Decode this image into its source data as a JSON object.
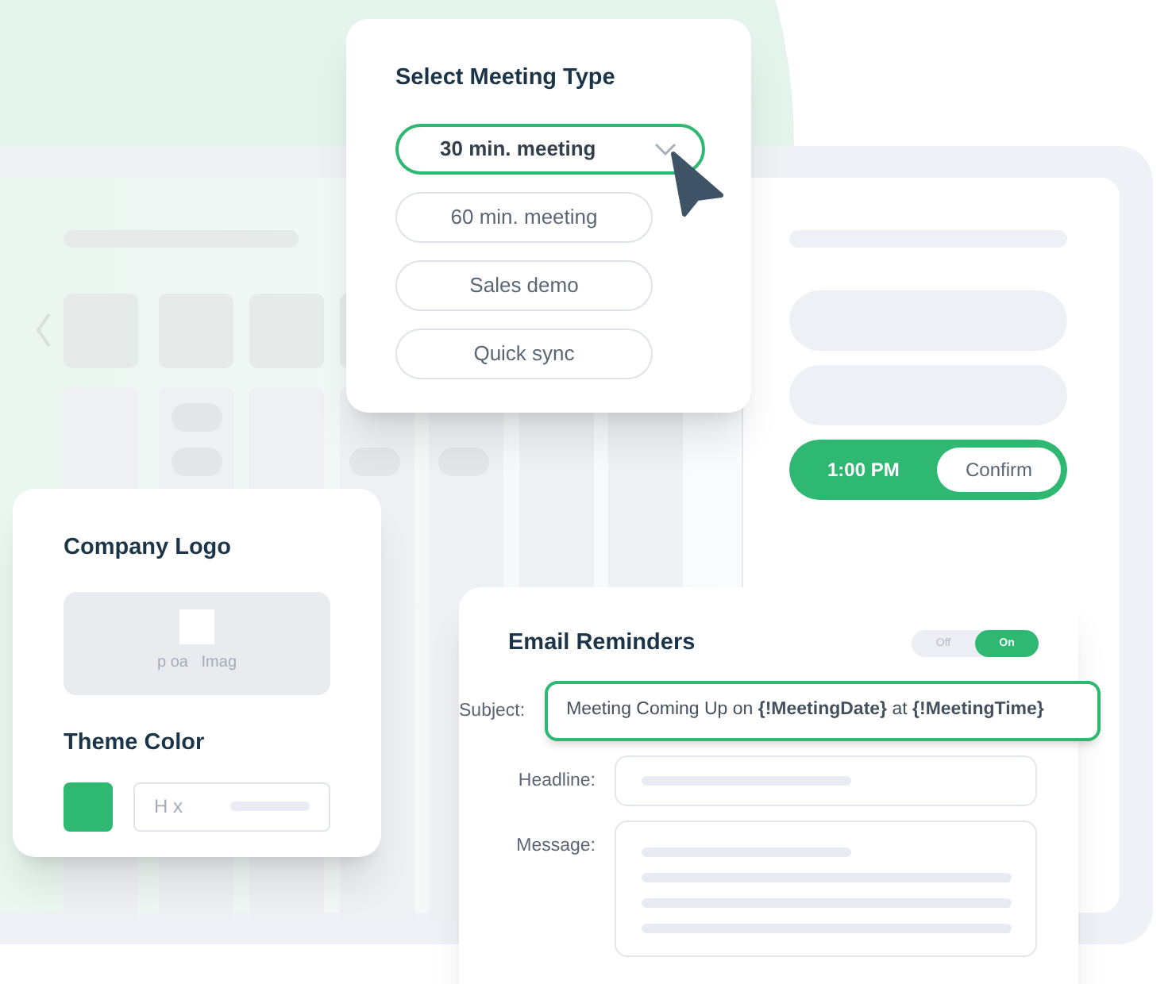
{
  "meeting_type": {
    "title": "Select Meeting Type",
    "options": [
      {
        "label": "30 min. meeting",
        "selected": true
      },
      {
        "label": "60 min. meeting",
        "selected": false
      },
      {
        "label": "Sales demo",
        "selected": false
      },
      {
        "label": "Quick sync",
        "selected": false
      }
    ]
  },
  "time_slot": {
    "time": "1:00 PM",
    "button": "Confirm"
  },
  "company_logo": {
    "title": "Company Logo",
    "upload_text": "p oa   Imag"
  },
  "theme_color": {
    "title": "Theme Color",
    "color": "#2eb872",
    "hex_placeholder": "H x"
  },
  "email_reminders": {
    "title": "Email Reminders",
    "toggle": [
      {
        "label": "Off",
        "selected": false
      },
      {
        "label": "On",
        "selected": true
      }
    ],
    "fields": [
      {
        "kind": "subject",
        "label": "Subject:",
        "value": "Meeting Coming Up on **{!MeetingDate}** at **{!MeetingTime}**"
      },
      {
        "kind": "line",
        "label": "Headline:"
      },
      {
        "kind": "multiline",
        "label": "Message:"
      }
    ]
  }
}
